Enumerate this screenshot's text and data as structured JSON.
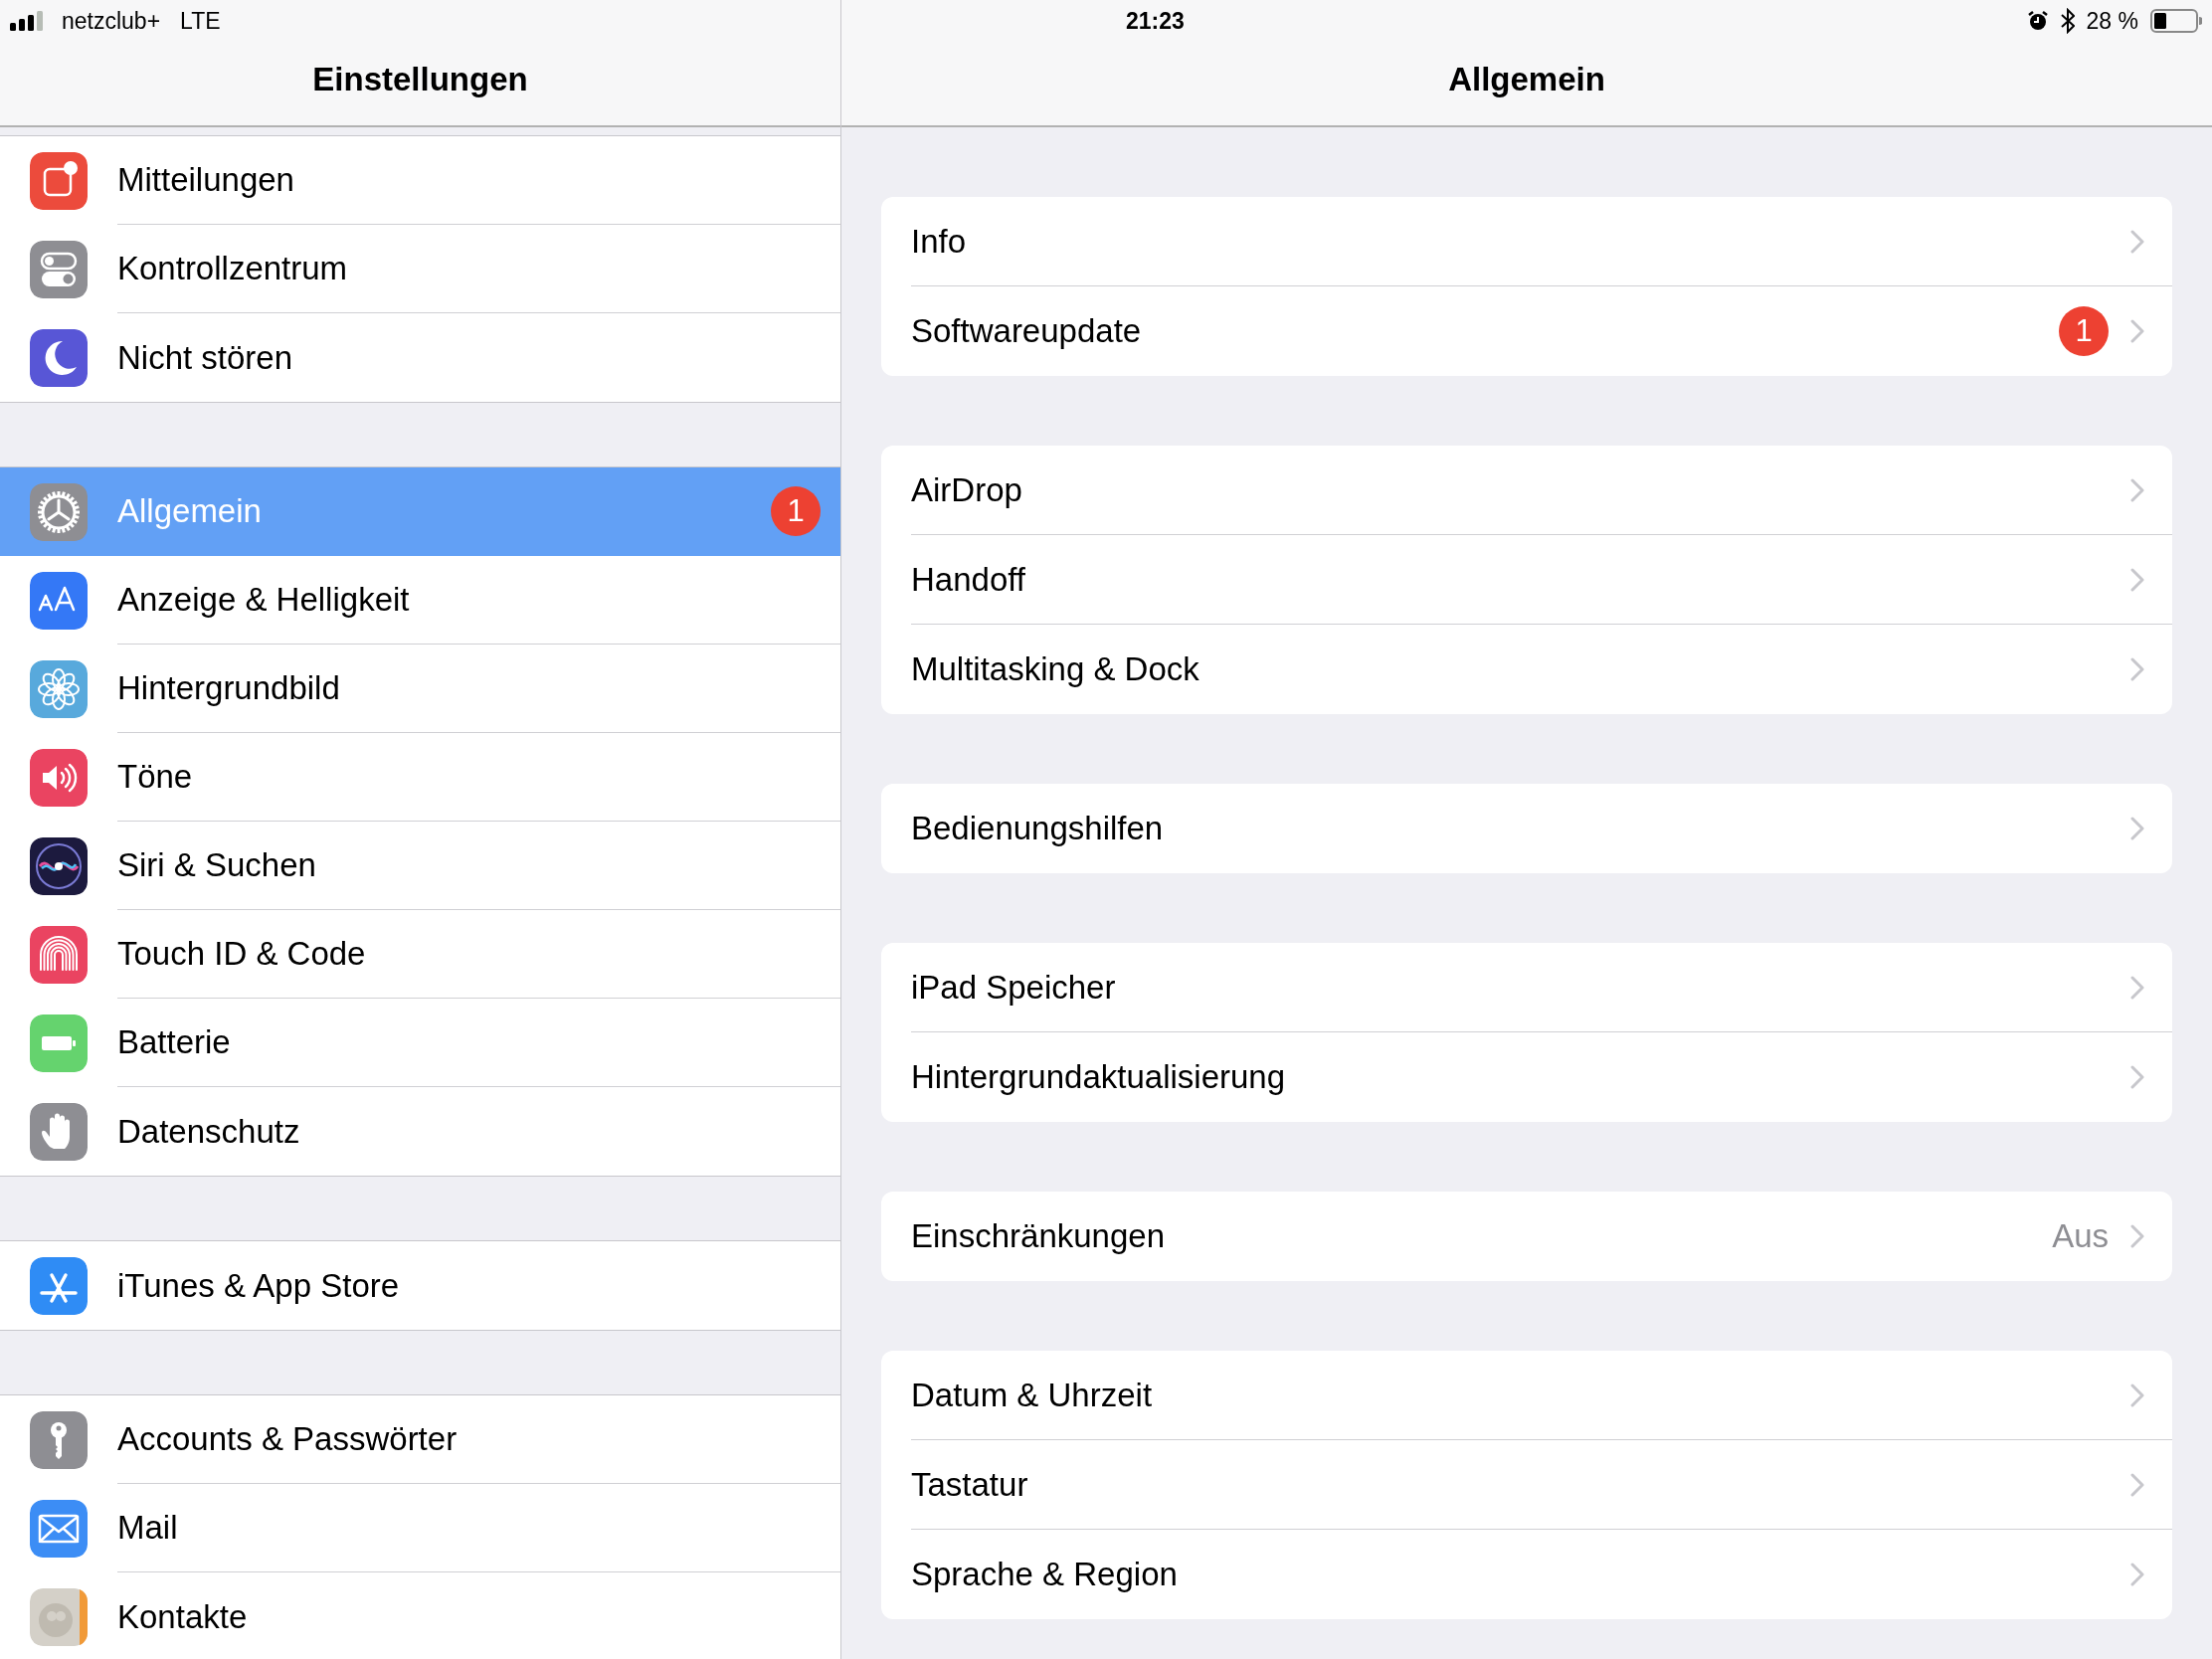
{
  "status_bar": {
    "carrier": "netzclub+",
    "network": "LTE",
    "time": "21:23",
    "battery": "28 %"
  },
  "sidebar": {
    "title": "Einstellungen",
    "groups": [
      {
        "items": [
          {
            "label": "Mitteilungen",
            "kind": "notifications",
            "selected": false
          },
          {
            "label": "Kontrollzentrum",
            "kind": "switches",
            "selected": false
          },
          {
            "label": "Nicht stören",
            "kind": "moon",
            "selected": false
          }
        ]
      },
      {
        "items": [
          {
            "label": "Allgemein",
            "kind": "gear",
            "selected": true,
            "badge": "1"
          },
          {
            "label": "Anzeige & Helligkeit",
            "kind": "textsize",
            "selected": false
          },
          {
            "label": "Hintergrundbild",
            "kind": "flower",
            "selected": false
          },
          {
            "label": "Töne",
            "kind": "speaker",
            "selected": false
          },
          {
            "label": "Siri & Suchen",
            "kind": "siri",
            "selected": false
          },
          {
            "label": "Touch ID & Code",
            "kind": "fingerprint",
            "selected": false
          },
          {
            "label": "Batterie",
            "kind": "battery",
            "selected": false
          },
          {
            "label": "Datenschutz",
            "kind": "hand",
            "selected": false
          }
        ]
      },
      {
        "items": [
          {
            "label": "iTunes & App Store",
            "kind": "appstore",
            "selected": false
          }
        ]
      },
      {
        "items": [
          {
            "label": "Accounts & Passwörter",
            "kind": "key",
            "selected": false
          },
          {
            "label": "Mail",
            "kind": "mail",
            "selected": false
          },
          {
            "label": "Kontakte",
            "kind": "contacts",
            "selected": false
          }
        ]
      }
    ]
  },
  "detail": {
    "title": "Allgemein",
    "groups": [
      {
        "items": [
          {
            "label": "Info"
          },
          {
            "label": "Softwareupdate",
            "badge": "1"
          }
        ]
      },
      {
        "items": [
          {
            "label": "AirDrop"
          },
          {
            "label": "Handoff"
          },
          {
            "label": "Multitasking & Dock"
          }
        ]
      },
      {
        "items": [
          {
            "label": "Bedienungshilfen"
          }
        ]
      },
      {
        "items": [
          {
            "label": "iPad Speicher"
          },
          {
            "label": "Hintergrundaktualisierung"
          }
        ]
      },
      {
        "items": [
          {
            "label": "Einschränkungen",
            "value": "Aus"
          }
        ]
      },
      {
        "items": [
          {
            "label": "Datum & Uhrzeit"
          },
          {
            "label": "Tastatur"
          },
          {
            "label": "Sprache & Region"
          }
        ]
      }
    ]
  }
}
